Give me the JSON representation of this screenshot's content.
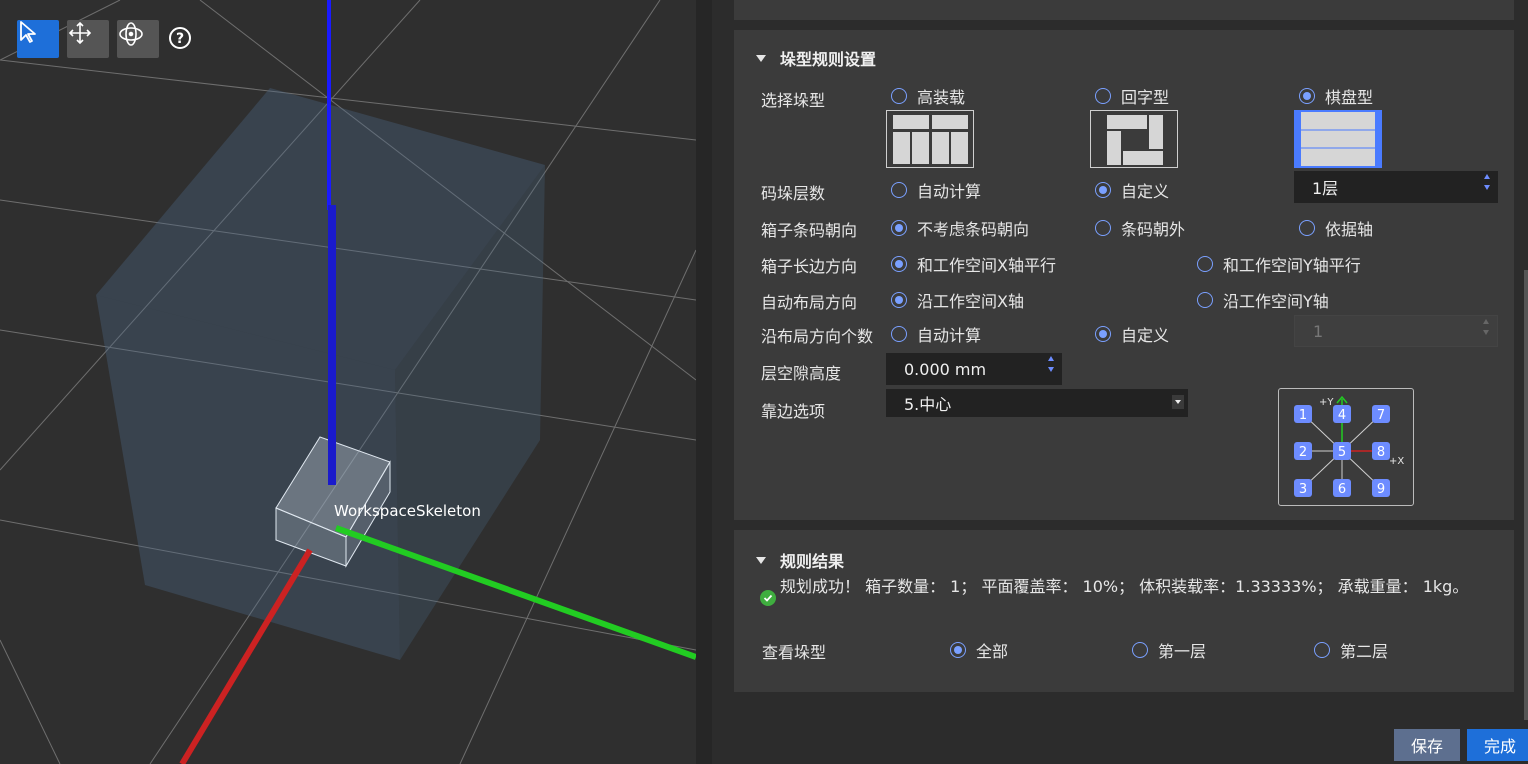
{
  "viewport": {
    "tools": [
      "select-tool",
      "move-tool",
      "rotate-tool"
    ],
    "help_glyph": "?",
    "object_label": "WorkspaceSkeleton"
  },
  "stack_rules": {
    "title": "垛型规则设置",
    "select_type_label": "选择垛型",
    "types": [
      {
        "label": "高装载",
        "selected": false
      },
      {
        "label": "回字型",
        "selected": false
      },
      {
        "label": "棋盘型",
        "selected": true
      }
    ],
    "layers_label": "码垛层数",
    "layers_options": [
      {
        "label": "自动计算",
        "selected": false
      },
      {
        "label": "自定义",
        "selected": true
      }
    ],
    "layers_value": "1层",
    "barcode_label": "箱子条码朝向",
    "barcode_options": [
      {
        "label": "不考虑条码朝向",
        "selected": true
      },
      {
        "label": "条码朝外",
        "selected": false
      },
      {
        "label": "依据轴",
        "selected": false
      }
    ],
    "long_edge_label": "箱子长边方向",
    "long_edge_options": [
      {
        "label": "和工作空间X轴平行",
        "selected": true
      },
      {
        "label": "和工作空间Y轴平行",
        "selected": false
      }
    ],
    "layout_dir_label": "自动布局方向",
    "layout_dir_options": [
      {
        "label": "沿工作空间X轴",
        "selected": true
      },
      {
        "label": "沿工作空间Y轴",
        "selected": false
      }
    ],
    "count_label": "沿布局方向个数",
    "count_options": [
      {
        "label": "自动计算",
        "selected": false
      },
      {
        "label": "自定义",
        "selected": true
      }
    ],
    "count_value": "1",
    "gap_label": "层空隙高度",
    "gap_value": "0.000 mm",
    "align_label": "靠边选项",
    "align_value": "5.中心",
    "grid": {
      "y_axis": "+Y",
      "x_axis": "+X",
      "cells": [
        "1",
        "4",
        "7",
        "2",
        "5",
        "8",
        "3",
        "6",
        "9"
      ]
    }
  },
  "results": {
    "title": "规则结果",
    "text": "规划成功！ 箱子数量： 1； 平面覆盖率： 10%； 体积装载率：1.33333%； 承载重量： 1kg。",
    "view_label": "查看垛型",
    "view_options": [
      {
        "label": "全部",
        "selected": true
      },
      {
        "label": "第一层",
        "selected": false
      },
      {
        "label": "第二层",
        "selected": false
      }
    ]
  },
  "buttons": {
    "save": "保存",
    "done": "完成"
  },
  "colors": {
    "accent": "#1e6fd9",
    "radio": "#7aa0ff",
    "x_axis": "#cc2222",
    "y_axis": "#22cc22",
    "z_axis": "#1a1aff"
  }
}
